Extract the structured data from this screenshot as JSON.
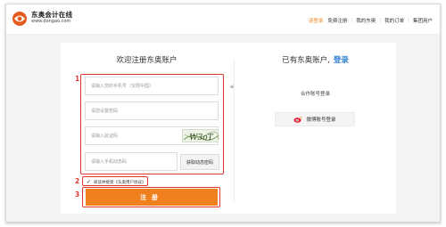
{
  "header": {
    "logo_name": "东奥会计在线",
    "logo_domain": "www.dongao.com",
    "nav": [
      {
        "label": "请登录",
        "active": true
      },
      {
        "label": "免费注册",
        "active": false
      },
      {
        "label": "我的东奥",
        "active": false
      },
      {
        "label": "我的订单",
        "active": false
      },
      {
        "label": "集团用户",
        "active": false
      }
    ]
  },
  "register": {
    "title": "欢迎注册东奥账户",
    "phone_placeholder": "请输入您的手机号（仅限中国）",
    "password_placeholder": "请您设置密码",
    "captcha_placeholder": "请输入验证码",
    "captcha_text": "W3oT",
    "sms_placeholder": "请输入手机动态码",
    "sms_button": "获取动态密码",
    "agree_check": "✓",
    "agree_text": "阅读并接受《东奥用户协议》",
    "submit_label": "注册"
  },
  "login": {
    "prompt": "已有东奥账户,",
    "login_link": "登录",
    "partner_title": "合作账号登录",
    "weibo_label": "微博账号登录"
  },
  "annotations": [
    "1",
    "2",
    "3"
  ],
  "colors": {
    "accent": "#f07f1e",
    "annotation": "#e0352b",
    "link": "#2f7fd1"
  }
}
